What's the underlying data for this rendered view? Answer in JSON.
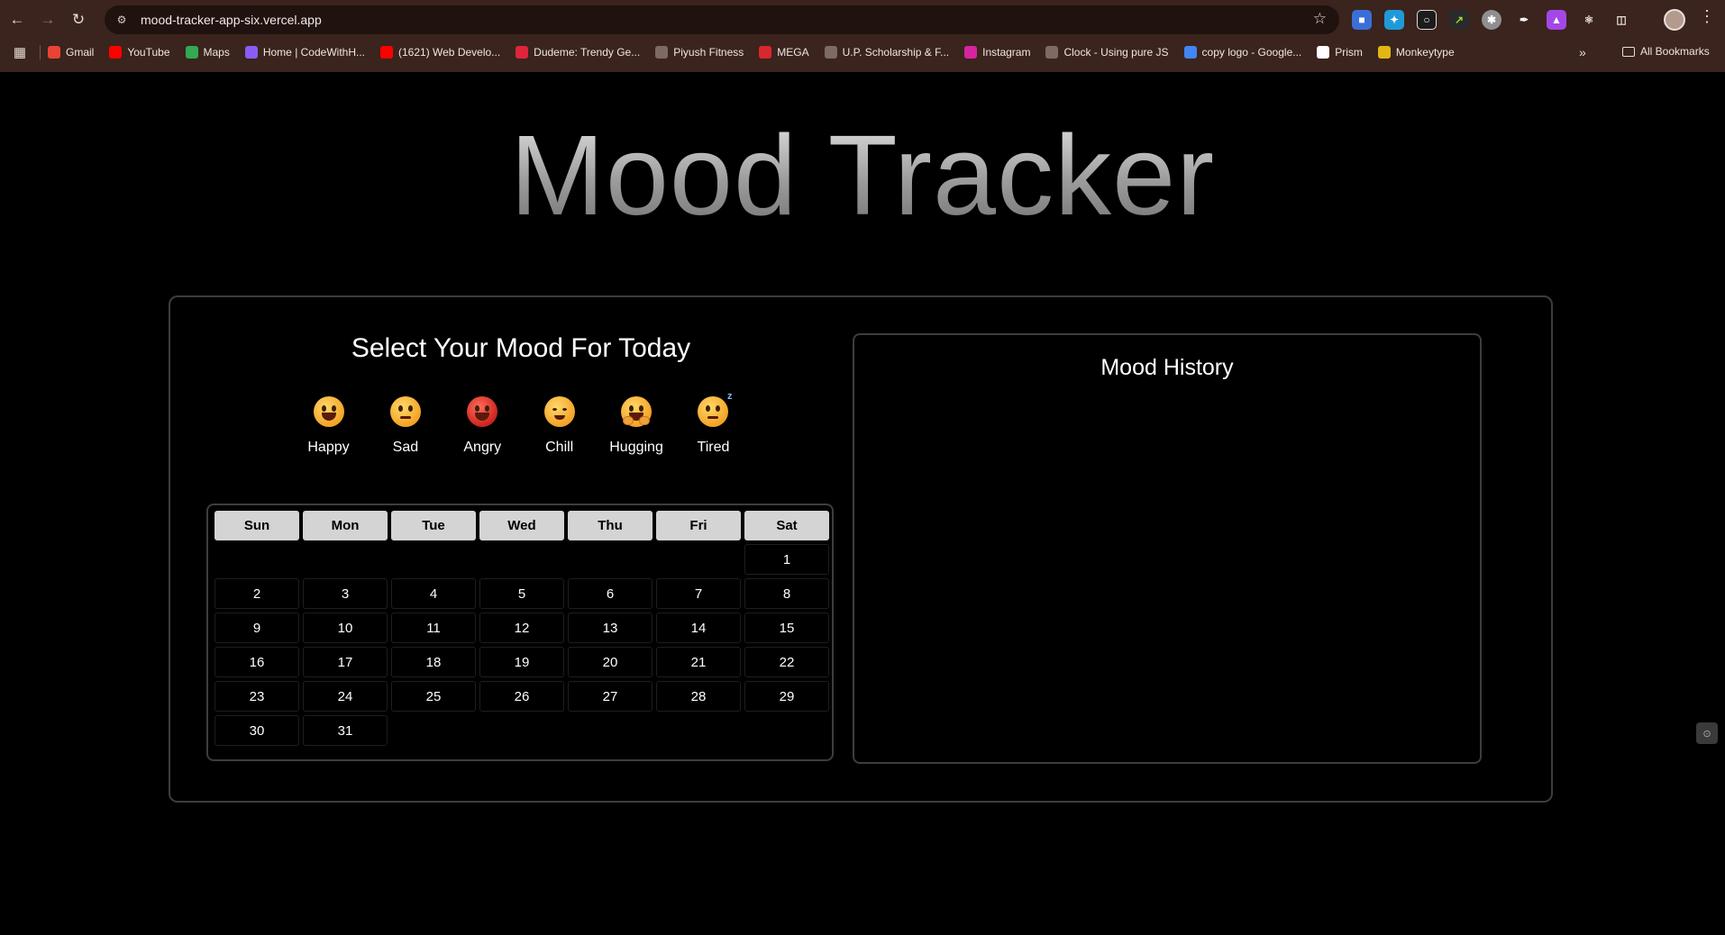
{
  "browser": {
    "url": "mood-tracker-app-six.vercel.app",
    "bookmarks": [
      {
        "label": "Gmail",
        "icon": "gmail-icon",
        "color": "#ea4335"
      },
      {
        "label": "YouTube",
        "icon": "youtube-icon",
        "color": "#ff0000"
      },
      {
        "label": "Maps",
        "icon": "maps-icon",
        "color": "#34a853"
      },
      {
        "label": "Home | CodeWithH...",
        "icon": "codewithharry-icon",
        "color": "#8a5cf6"
      },
      {
        "label": "(1621) Web Develo...",
        "icon": "youtube-icon",
        "color": "#ff0000"
      },
      {
        "label": "Dudeme: Trendy Ge...",
        "icon": "dudeme-icon",
        "color": "#e0243c"
      },
      {
        "label": "Piyush Fitness",
        "icon": "globe-icon",
        "color": "#7d6a63"
      },
      {
        "label": "MEGA",
        "icon": "mega-icon",
        "color": "#d9272e"
      },
      {
        "label": "U.P. Scholarship & F...",
        "icon": "globe-icon",
        "color": "#7d6a63"
      },
      {
        "label": "Instagram",
        "icon": "instagram-icon",
        "color": "#d6249f"
      },
      {
        "label": "Clock - Using pure JS",
        "icon": "globe-icon",
        "color": "#7d6a63"
      },
      {
        "label": "copy logo - Google...",
        "icon": "google-icon",
        "color": "#4285f4"
      },
      {
        "label": "Prism",
        "icon": "prism-icon",
        "color": "#ffffff"
      },
      {
        "label": "Monkeytype",
        "icon": "monkeytype-icon",
        "color": "#e2b714"
      }
    ],
    "all_bookmarks": "All Bookmarks"
  },
  "app": {
    "title": "Mood Tracker",
    "mood_heading": "Select Your Mood For Today",
    "moods": [
      {
        "label": "Happy",
        "icon": "happy-emoji-icon"
      },
      {
        "label": "Sad",
        "icon": "sad-emoji-icon"
      },
      {
        "label": "Angry",
        "icon": "angry-emoji-icon"
      },
      {
        "label": "Chill",
        "icon": "chill-emoji-icon"
      },
      {
        "label": "Hugging",
        "icon": "hugging-emoji-icon"
      },
      {
        "label": "Tired",
        "icon": "tired-emoji-icon"
      }
    ],
    "calendar": {
      "weekdays": [
        "Sun",
        "Mon",
        "Tue",
        "Wed",
        "Thu",
        "Fri",
        "Sat"
      ],
      "leading_blanks": 6,
      "days": [
        "1",
        "2",
        "3",
        "4",
        "5",
        "6",
        "7",
        "8",
        "9",
        "10",
        "11",
        "12",
        "13",
        "14",
        "15",
        "16",
        "17",
        "18",
        "19",
        "20",
        "21",
        "22",
        "23",
        "24",
        "25",
        "26",
        "27",
        "28",
        "29",
        "30",
        "31"
      ]
    },
    "history_title": "Mood History"
  }
}
